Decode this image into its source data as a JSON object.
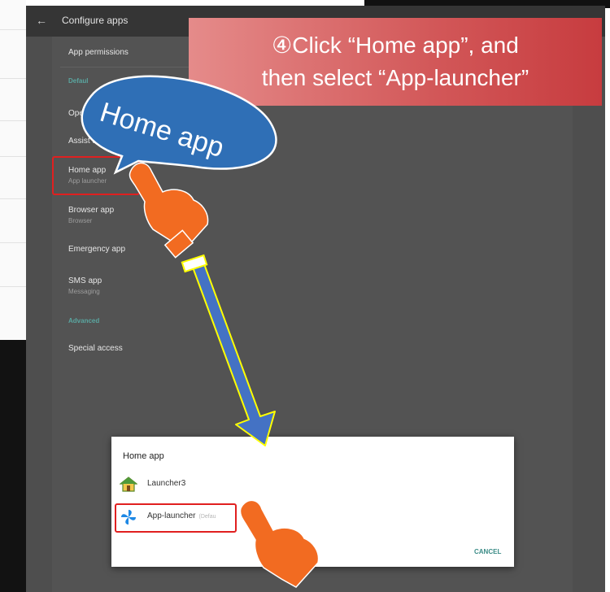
{
  "header": {
    "title": "Configure apps"
  },
  "settings": {
    "app_permissions": "App permissions",
    "defaults_label": "Defaul",
    "open_label": "Open",
    "assist_label": "Assist & voic",
    "home_app": {
      "title": "Home app",
      "value": "App launcher"
    },
    "browser_app": {
      "title": "Browser app",
      "value": "Browser"
    },
    "emergency_app": "Emergency app",
    "sms_app": {
      "title": "SMS app",
      "value": "Messaging"
    },
    "advanced_label": "Advanced",
    "special_access": "Special access"
  },
  "callout": {
    "line1": "④Click “Home app”, and",
    "line2": "then select “App-launcher”"
  },
  "bubble": {
    "text": "Home app"
  },
  "dialog": {
    "title": "Home app",
    "options": [
      {
        "label": "Launcher3",
        "icon": "house-icon",
        "default_tag": ""
      },
      {
        "label": "App-launcher",
        "icon": "pinwheel-icon",
        "default_tag": "(Defau"
      }
    ],
    "cancel": "CANCEL"
  },
  "colors": {
    "callout": "#d25758",
    "bubble": "#2f6fb6",
    "hand": "#f26b21",
    "arrow_fill": "#4472c4",
    "arrow_stroke": "#ffff00",
    "highlight": "#e02020",
    "accent": "#3a8b86"
  }
}
